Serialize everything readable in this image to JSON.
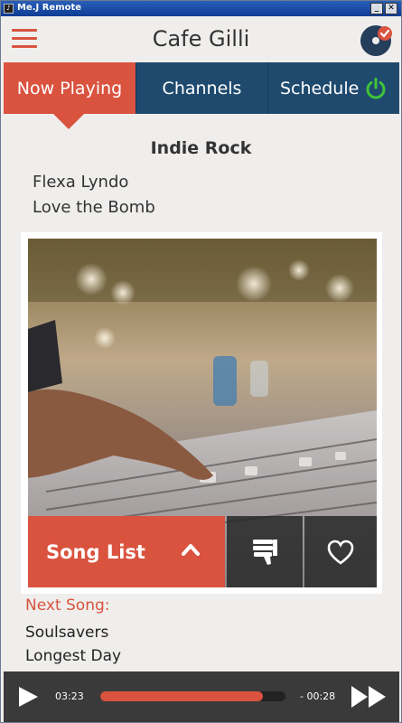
{
  "window": {
    "title": "Me.J Remote",
    "icon_text": "♪",
    "minimize": "_",
    "close": "✕"
  },
  "header": {
    "venue": "Cafe Gilli",
    "menu_icon": "hamburger-icon",
    "logo_icon": "vinyl-check-icon"
  },
  "tabs": [
    {
      "label": "Now Playing",
      "active": true
    },
    {
      "label": "Channels",
      "active": false
    },
    {
      "label": "Schedule",
      "active": false,
      "icon": "power-icon"
    }
  ],
  "now_playing": {
    "genre": "Indie Rock",
    "artist": "Flexa Lyndo",
    "track": "Love the Bomb",
    "artwork": "mixing-console-photo"
  },
  "actions": {
    "song_list_label": "Song List",
    "song_list_icon": "chevron-up-icon",
    "dislike_icon": "thumbs-down-icon",
    "like_icon": "heart-icon"
  },
  "next_song": {
    "label": "Next Song:",
    "artist": "Soulsavers",
    "track": "Longest Day"
  },
  "player": {
    "elapsed": "03:23",
    "remaining": "- 00:28",
    "progress_fraction": 0.88,
    "play_icon": "play-icon",
    "skip_icon": "fast-forward-icon"
  },
  "colors": {
    "accent": "#d9533f",
    "tab_inactive": "#1f4a6e",
    "power_green": "#3ec43a",
    "player_bg": "#3a3a3a"
  }
}
